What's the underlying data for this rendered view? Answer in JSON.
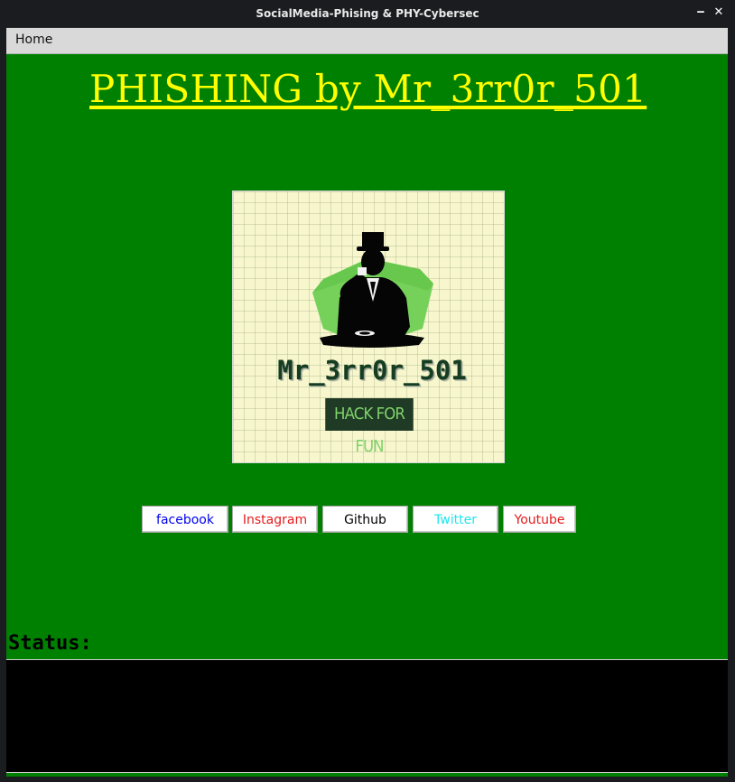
{
  "window": {
    "title": "SocialMedia-Phising & PHY-Cybersec",
    "minimize_glyph": "‒",
    "close_glyph": "✕"
  },
  "menu": {
    "items": [
      {
        "label": "Home"
      }
    ]
  },
  "main": {
    "heading": "PHISHING by Mr_3rr0r_501",
    "logo": {
      "name_text": "Mr_3rr0r_501",
      "badge_text": "HACK FOR FUN"
    },
    "buttons": [
      {
        "label": "facebook",
        "color": "#0000ee"
      },
      {
        "label": "Instagram",
        "color": "#e51b1b"
      },
      {
        "label": "Github",
        "color": "#000000"
      },
      {
        "label": "Twitter",
        "color": "#1ee6ee"
      },
      {
        "label": "Youtube",
        "color": "#e51b1b"
      }
    ],
    "status_label": "Status:",
    "status_text": ""
  },
  "colors": {
    "background": "#008000",
    "heading": "#ffff00",
    "status_box": "#000000"
  }
}
